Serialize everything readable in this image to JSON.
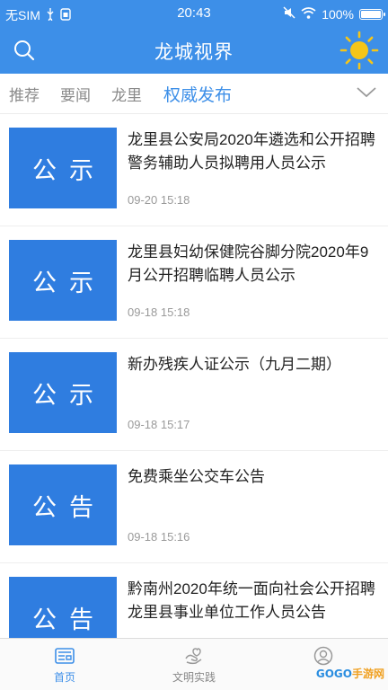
{
  "status": {
    "carrier": "无SIM",
    "time": "20:43",
    "battery": "100%",
    "battery_level": 1.0
  },
  "header": {
    "title": "龙城视界",
    "search_icon": "search-icon",
    "weather_icon": "sun-icon"
  },
  "tabs": [
    {
      "label": "推荐",
      "active": false
    },
    {
      "label": "要闻",
      "active": false
    },
    {
      "label": "龙里",
      "active": false
    },
    {
      "label": "权威发布",
      "active": true
    }
  ],
  "news": [
    {
      "thumb": "公示",
      "title": "龙里县公安局2020年遴选和公开招聘警务辅助人员拟聘用人员公示",
      "date": "09-20 15:18"
    },
    {
      "thumb": "公示",
      "title": "龙里县妇幼保健院谷脚分院2020年9月公开招聘临聘人员公示",
      "date": "09-18 15:18"
    },
    {
      "thumb": "公示",
      "title": "新办残疾人证公示（九月二期）",
      "date": "09-18 15:17"
    },
    {
      "thumb": "公告",
      "title": "免费乘坐公交车公告",
      "date": "09-18 15:16"
    },
    {
      "thumb": "公告",
      "title": "黔南州2020年统一面向社会公开招聘龙里县事业单位工作人员公告",
      "date": ""
    }
  ],
  "bottom_nav": [
    {
      "label": "首页",
      "icon": "news-icon",
      "active": true
    },
    {
      "label": "文明实践",
      "icon": "hands-icon",
      "active": false
    },
    {
      "label": "",
      "icon": "user-icon",
      "active": false
    }
  ],
  "watermark": {
    "prefix": "GOGO",
    "suffix": "手游网"
  },
  "colors": {
    "brand": "#3d8fe8",
    "thumb": "#2f7de0",
    "sun": "#f5c518"
  }
}
